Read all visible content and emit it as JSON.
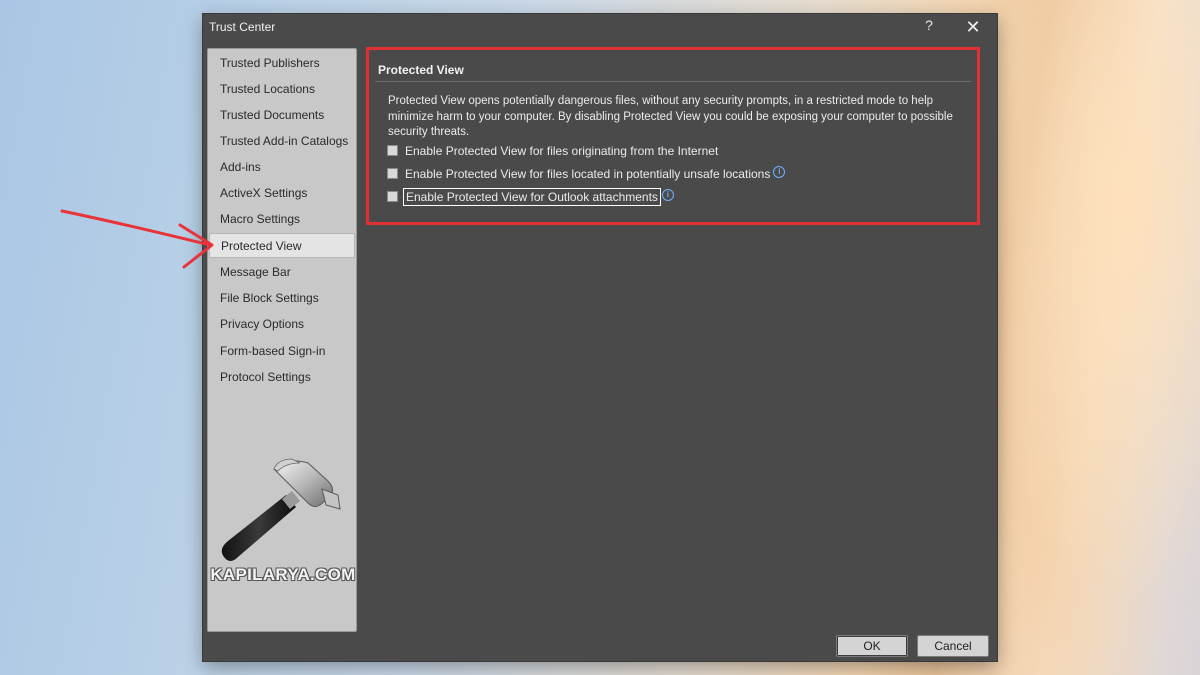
{
  "window": {
    "title": "Trust Center",
    "help_label": "?",
    "close_label": "✕"
  },
  "sidebar": {
    "items": [
      {
        "label": "Trusted Publishers"
      },
      {
        "label": "Trusted Locations"
      },
      {
        "label": "Trusted Documents"
      },
      {
        "label": "Trusted Add-in Catalogs"
      },
      {
        "label": "Add-ins"
      },
      {
        "label": "ActiveX Settings"
      },
      {
        "label": "Macro Settings"
      },
      {
        "label": "Protected View"
      },
      {
        "label": "Message Bar"
      },
      {
        "label": "File Block Settings"
      },
      {
        "label": "Privacy Options"
      },
      {
        "label": "Form-based Sign-in"
      },
      {
        "label": "Protocol Settings"
      }
    ],
    "selected": "Protected View",
    "logo_text": "KAPILARYA.COM"
  },
  "main": {
    "section_title": "Protected View",
    "description": "Protected View opens potentially dangerous files, without any security prompts, in a restricted mode to help minimize harm to your computer. By disabling Protected View you could be exposing your computer to possible security threats.",
    "checkboxes": [
      {
        "label": "Enable Protected View for files originating from the Internet",
        "checked": false,
        "info": false
      },
      {
        "label": "Enable Protected View for files located in potentially unsafe locations",
        "checked": false,
        "info": true
      },
      {
        "label": "Enable Protected View for Outlook attachments",
        "checked": false,
        "info": true
      }
    ]
  },
  "footer": {
    "ok_label": "OK",
    "cancel_label": "Cancel"
  },
  "colors": {
    "dialog_bg": "#4a4a4a",
    "sidebar_bg": "#c8c8c8",
    "highlight_frame": "#e03030",
    "annotation_arrow": "#e8333a"
  },
  "icons": {
    "info": "info-circle-icon",
    "close": "close-icon",
    "help": "help-icon"
  }
}
